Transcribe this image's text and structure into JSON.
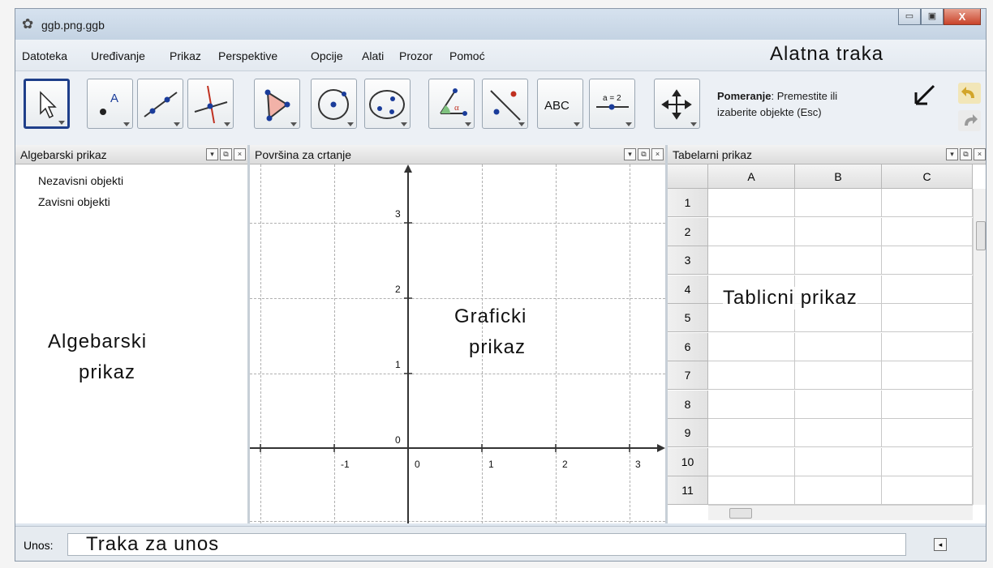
{
  "window": {
    "title": "ggb.png.ggb",
    "close_label": "X",
    "min_label": "▭",
    "max_label": "▣"
  },
  "menu": [
    "Datoteka",
    "Uređivanje",
    "Prikaz",
    "Perspektive",
    "Opcije",
    "Alati",
    "Prozor",
    "Pomoć"
  ],
  "notes": {
    "toolbar": "Alatna traka",
    "algebra": [
      "Algebarski",
      "prikaz"
    ],
    "graphics": [
      "Graficki",
      "prikaz"
    ],
    "spreadsheet": "Tablicni prikaz",
    "input": "Traka za unos"
  },
  "toolbar": {
    "tools": [
      "move-tool",
      "point-tool",
      "line-tool",
      "perpendicular-line-tool",
      "polygon-tool",
      "circle-tool",
      "conic-tool",
      "angle-tool",
      "reflect-tool",
      "text-tool",
      "slider-tool",
      "move-view-tool"
    ],
    "text_tool_label": "ABC",
    "slider_tool_label": "a = 2",
    "desc_name": "Pomeranje",
    "desc_rest": ": Premestite ili",
    "desc_line2": "izaberite objekte (Esc)"
  },
  "algebra_view": {
    "title": "Algebarski prikaz",
    "items": [
      "Nezavisni objekti",
      "Zavisni objekti"
    ]
  },
  "graphics_view": {
    "title": "Površina za crtanje",
    "x_ticks": [
      "-1",
      "0",
      "1",
      "2",
      "3"
    ],
    "y_ticks": [
      "3",
      "2",
      "1",
      "0"
    ]
  },
  "spreadsheet_view": {
    "title": "Tabelarni prikaz",
    "columns": [
      "A",
      "B",
      "C"
    ],
    "rows": [
      "1",
      "2",
      "3",
      "4",
      "5",
      "6",
      "7",
      "8",
      "9",
      "10",
      "11"
    ]
  },
  "input_bar": {
    "label": "Unos:"
  }
}
